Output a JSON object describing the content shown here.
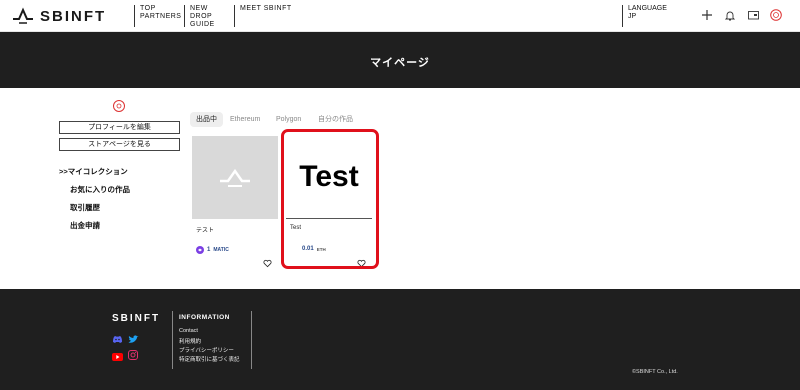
{
  "header": {
    "logo_text": "SBINFT",
    "nav": [
      {
        "line1": "TOP",
        "line2": "PARTNERS"
      },
      {
        "line1": "NEW DROP",
        "line2": "GUIDE"
      },
      {
        "line1": "MEET SBINFT",
        "line2": ""
      }
    ],
    "language": {
      "label": "LANGUAGE",
      "value": "JP"
    },
    "icons": [
      "plus-icon",
      "bell-icon",
      "wallet-icon",
      "avatar-icon"
    ]
  },
  "banner": {
    "title": "マイページ"
  },
  "sidebar": {
    "buttons": [
      "プロフィールを編集",
      "ストアページを見る"
    ],
    "links": [
      ">>マイコレクション",
      "お気に入りの作品",
      "取引履歴",
      "出金申請"
    ]
  },
  "tabs": [
    {
      "label": "出品中",
      "active": true
    },
    {
      "label": "Ethereum",
      "active": false
    },
    {
      "label": "Polygon",
      "active": false
    },
    {
      "label": "自分の作品",
      "active": false
    }
  ],
  "cards": [
    {
      "name": "テスト",
      "price": "1",
      "unit": "MATIC",
      "image": "placeholder-logo"
    },
    {
      "name": "Test",
      "price": "0.01",
      "unit": "ETH",
      "image_text": "Test"
    }
  ],
  "footer": {
    "logo_text": "SBINFT",
    "info_title": "INFORMATION",
    "links": [
      "Contact",
      "利用規約",
      "プライバシーポリシー",
      "特定商取引に基づく表記"
    ],
    "copyright": "©SBINFT Co., Ltd."
  },
  "colors": {
    "accent_red": "#e0101b",
    "dark": "#1f1f1f",
    "price_blue": "#2a4a8a"
  }
}
